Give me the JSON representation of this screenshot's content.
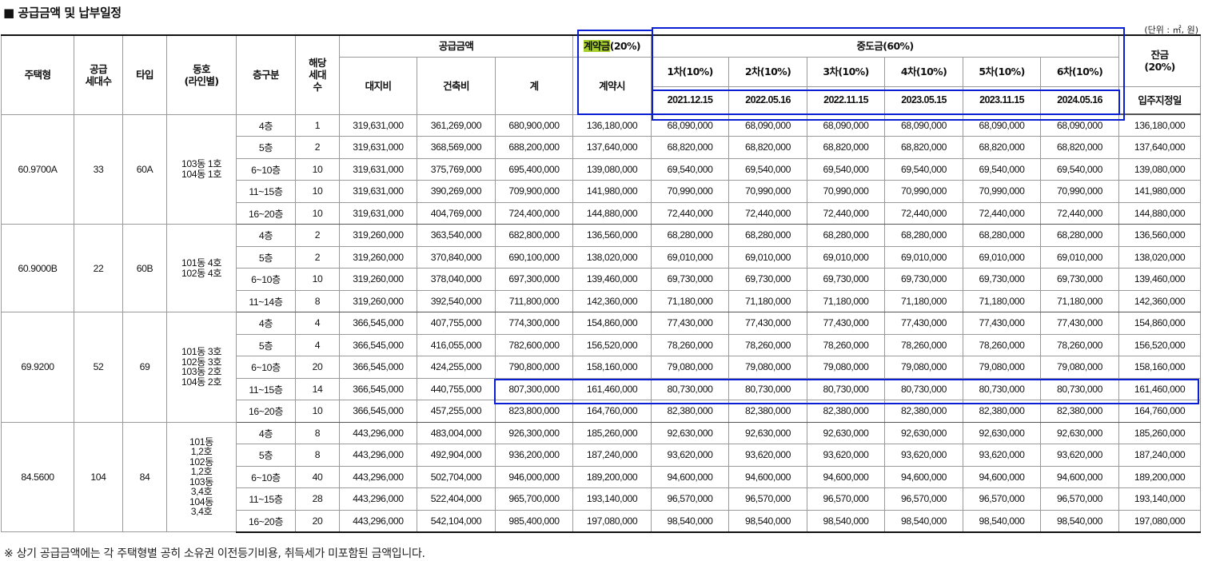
{
  "title": "■ 공급금액 및 납부일정",
  "unit": "(단위 : ㎡, 원)",
  "headers": {
    "house_type": "주택형",
    "supply_units": "공급\n세대수",
    "type": "타입",
    "dongho": "동호\n(라인별)",
    "floor": "층구분",
    "units": "해당\n세대\n수",
    "supply_price": "공급금액",
    "land": "대지비",
    "building": "건축비",
    "total": "계",
    "contract_highlight": "계약금",
    "contract_rest": "(20%)",
    "contract_when": "계약시",
    "middle": "중도금(60%)",
    "installments": [
      "1차(10%)",
      "2차(10%)",
      "3차(10%)",
      "4차(10%)",
      "5차(10%)",
      "6차(10%)"
    ],
    "dates": [
      "2021.12.15",
      "2022.05.16",
      "2022.11.15",
      "2023.05.15",
      "2023.11.15",
      "2024.05.16"
    ],
    "balance": "잔금\n(20%)",
    "balance_when": "입주지정일"
  },
  "groups": [
    {
      "house_type": "60.9700A",
      "supply_units": "33",
      "type": "60A",
      "dongho": [
        "103동 1호",
        "104동 1호"
      ],
      "rows": [
        {
          "floor": "4층",
          "units": "1",
          "land": "319,631,000",
          "building": "361,269,000",
          "total": "680,900,000",
          "contract": "136,180,000",
          "middle": "68,090,000",
          "balance": "136,180,000"
        },
        {
          "floor": "5층",
          "units": "2",
          "land": "319,631,000",
          "building": "368,569,000",
          "total": "688,200,000",
          "contract": "137,640,000",
          "middle": "68,820,000",
          "balance": "137,640,000"
        },
        {
          "floor": "6~10층",
          "units": "10",
          "land": "319,631,000",
          "building": "375,769,000",
          "total": "695,400,000",
          "contract": "139,080,000",
          "middle": "69,540,000",
          "balance": "139,080,000"
        },
        {
          "floor": "11~15층",
          "units": "10",
          "land": "319,631,000",
          "building": "390,269,000",
          "total": "709,900,000",
          "contract": "141,980,000",
          "middle": "70,990,000",
          "balance": "141,980,000"
        },
        {
          "floor": "16~20층",
          "units": "10",
          "land": "319,631,000",
          "building": "404,769,000",
          "total": "724,400,000",
          "contract": "144,880,000",
          "middle": "72,440,000",
          "balance": "144,880,000"
        }
      ]
    },
    {
      "house_type": "60.9000B",
      "supply_units": "22",
      "type": "60B",
      "dongho": [
        "101동 4호",
        "102동 4호"
      ],
      "rows": [
        {
          "floor": "4층",
          "units": "2",
          "land": "319,260,000",
          "building": "363,540,000",
          "total": "682,800,000",
          "contract": "136,560,000",
          "middle": "68,280,000",
          "balance": "136,560,000"
        },
        {
          "floor": "5층",
          "units": "2",
          "land": "319,260,000",
          "building": "370,840,000",
          "total": "690,100,000",
          "contract": "138,020,000",
          "middle": "69,010,000",
          "balance": "138,020,000"
        },
        {
          "floor": "6~10층",
          "units": "10",
          "land": "319,260,000",
          "building": "378,040,000",
          "total": "697,300,000",
          "contract": "139,460,000",
          "middle": "69,730,000",
          "balance": "139,460,000"
        },
        {
          "floor": "11~14층",
          "units": "8",
          "land": "319,260,000",
          "building": "392,540,000",
          "total": "711,800,000",
          "contract": "142,360,000",
          "middle": "71,180,000",
          "balance": "142,360,000"
        }
      ]
    },
    {
      "house_type": "69.9200",
      "supply_units": "52",
      "type": "69",
      "dongho": [
        "101동 3호",
        "102동 3호",
        "103동 2호",
        "104동 2호"
      ],
      "rows": [
        {
          "floor": "4층",
          "units": "4",
          "land": "366,545,000",
          "building": "407,755,000",
          "total": "774,300,000",
          "contract": "154,860,000",
          "middle": "77,430,000",
          "balance": "154,860,000"
        },
        {
          "floor": "5층",
          "units": "4",
          "land": "366,545,000",
          "building": "416,055,000",
          "total": "782,600,000",
          "contract": "156,520,000",
          "middle": "78,260,000",
          "balance": "156,520,000"
        },
        {
          "floor": "6~10층",
          "units": "20",
          "land": "366,545,000",
          "building": "424,255,000",
          "total": "790,800,000",
          "contract": "158,160,000",
          "middle": "79,080,000",
          "balance": "158,160,000"
        },
        {
          "floor": "11~15층",
          "units": "14",
          "land": "366,545,000",
          "building": "440,755,000",
          "total": "807,300,000",
          "contract": "161,460,000",
          "middle": "80,730,000",
          "balance": "161,460,000"
        },
        {
          "floor": "16~20층",
          "units": "10",
          "land": "366,545,000",
          "building": "457,255,000",
          "total": "823,800,000",
          "contract": "164,760,000",
          "middle": "82,380,000",
          "balance": "164,760,000"
        }
      ]
    },
    {
      "house_type": "84.5600",
      "supply_units": "104",
      "type": "84",
      "dongho": [
        "101동",
        "1,2호",
        "102동",
        "1,2호",
        "103동",
        "3,4호",
        "104동",
        "3,4호"
      ],
      "rows": [
        {
          "floor": "4층",
          "units": "8",
          "land": "443,296,000",
          "building": "483,004,000",
          "total": "926,300,000",
          "contract": "185,260,000",
          "middle": "92,630,000",
          "balance": "185,260,000"
        },
        {
          "floor": "5층",
          "units": "8",
          "land": "443,296,000",
          "building": "492,904,000",
          "total": "936,200,000",
          "contract": "187,240,000",
          "middle": "93,620,000",
          "balance": "187,240,000"
        },
        {
          "floor": "6~10층",
          "units": "40",
          "land": "443,296,000",
          "building": "502,704,000",
          "total": "946,000,000",
          "contract": "189,200,000",
          "middle": "94,600,000",
          "balance": "189,200,000"
        },
        {
          "floor": "11~15층",
          "units": "28",
          "land": "443,296,000",
          "building": "522,404,000",
          "total": "965,700,000",
          "contract": "193,140,000",
          "middle": "96,570,000",
          "balance": "193,140,000"
        },
        {
          "floor": "16~20층",
          "units": "20",
          "land": "443,296,000",
          "building": "542,104,000",
          "total": "985,400,000",
          "contract": "197,080,000",
          "middle": "98,540,000",
          "balance": "197,080,000"
        }
      ]
    }
  ],
  "note": "※ 상기 공급금액에는 각 주택형별 공히 소유권 이전등기비용, 취득세가 미포함된 금액입니다.",
  "colors": {
    "highlight": "#a6cf2c",
    "annotation_box": "#0a1fd3"
  }
}
